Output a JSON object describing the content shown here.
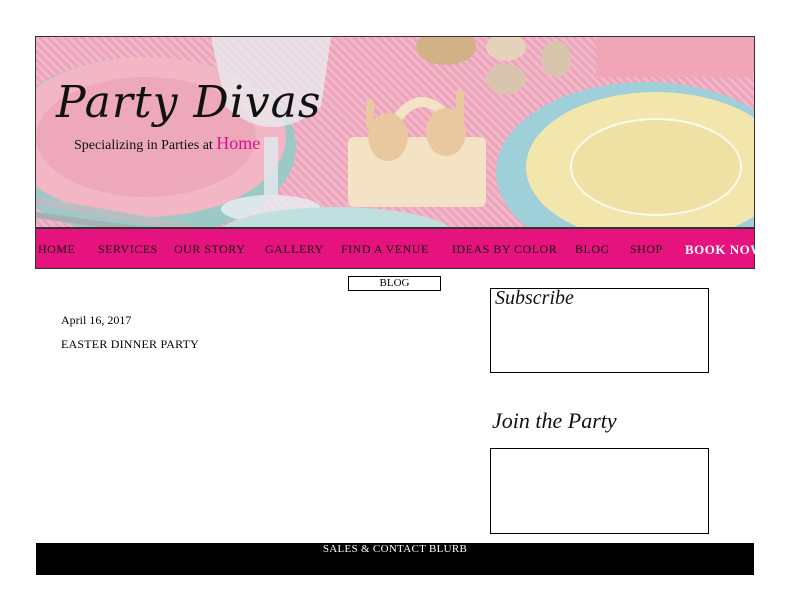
{
  "brand": {
    "name": "Party Divas",
    "tagline_prefix": "Specializing in Parties at",
    "tagline_highlight": "Home",
    "highlight_color": "#e0118a"
  },
  "nav": {
    "background": "#e6127d",
    "items": [
      {
        "label": "HOME"
      },
      {
        "label": "SERVICES"
      },
      {
        "label": "OUR STORY"
      },
      {
        "label": "GALLERY"
      },
      {
        "label": "FIND A VENUE"
      },
      {
        "label": "IDEAS BY COLOR"
      },
      {
        "label": "BLOG"
      },
      {
        "label": "SHOP"
      }
    ],
    "cta_label": "BOOK NOW"
  },
  "main": {
    "section_label": "BLOG",
    "post": {
      "date": "April 16, 2017",
      "title": "EASTER DINNER PARTY"
    }
  },
  "sidebar": {
    "subscribe_title": "Subscribe",
    "join_title": "Join the Party"
  },
  "footer": {
    "text": "SALES & CONTACT BLURB"
  }
}
